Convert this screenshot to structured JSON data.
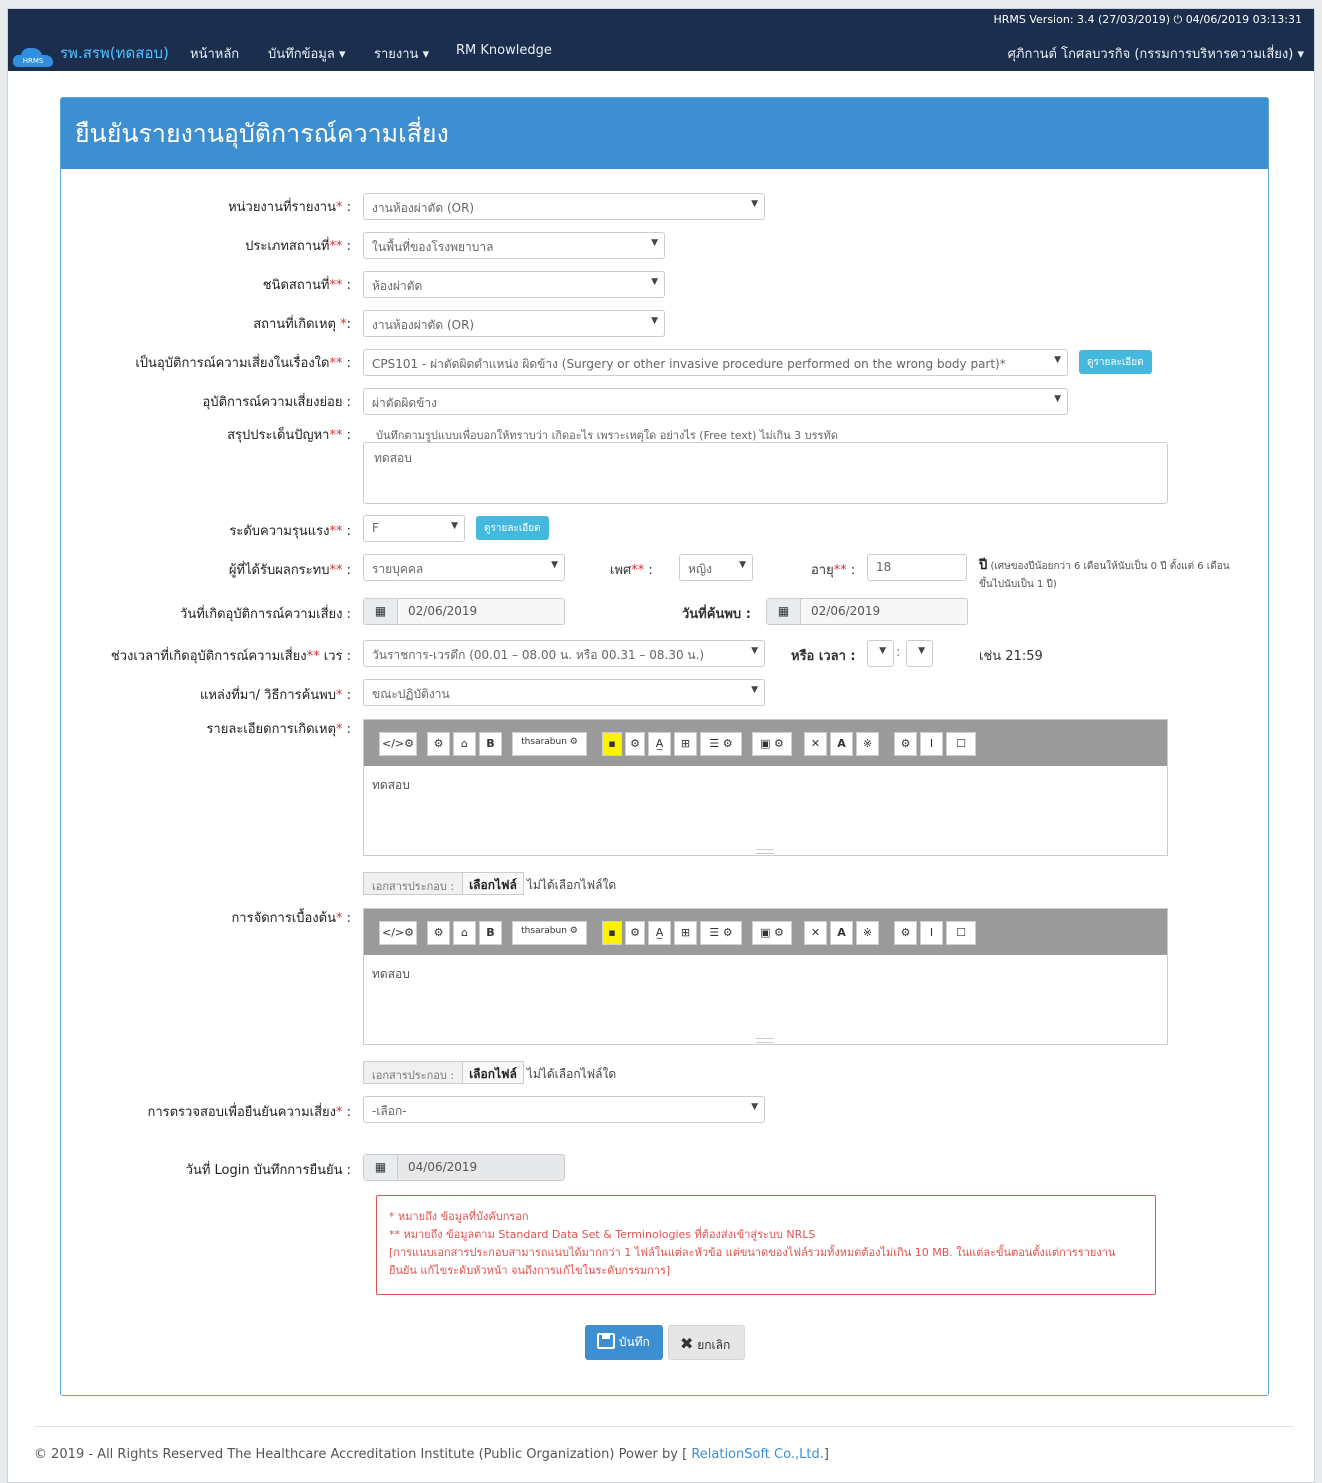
{
  "nav": {
    "version": "HRMS Version: 3.4 (27/03/2019) ⏻ 04/06/2019 03:13:31",
    "logo_text": "HRMS",
    "brand": "รพ.สรพ(ทดสอบ)",
    "items": [
      "หน้าหลัก",
      "บันทึกข้อมูล ▾",
      "รายงาน ▾",
      "RM Knowledge"
    ],
    "user": "ศุภิกานต์ โกศลบวรกิจ (กรรมการบริหารความเสี่ยง) ▾"
  },
  "panel_title": "ยืนยันรายงานอุบัติการณ์ความเสี่ยง",
  "form": {
    "unit": {
      "label": "หน่วยงานที่รายงาน",
      "req": "*",
      "value": "งานห้องผ่าตัด (OR)"
    },
    "place_type": {
      "label": "ประเภทสถานที่",
      "req": "**",
      "value": "ในพื้นที่ของโรงพยาบาล"
    },
    "place_kind": {
      "label": "ชนิดสถานที่",
      "req": "**",
      "value": "ห้องผ่าตัด"
    },
    "place": {
      "label": "สถานที่เกิดเหตุ",
      "req": "*",
      "value": "งานห้องผ่าตัด (OR)"
    },
    "risk_topic": {
      "label": "เป็นอุบัติการณ์ความเสี่ยงในเรื่องใด",
      "req": "**",
      "value": "CPS101 - ผ่าตัดผิดตำแหน่ง ผิดข้าง (Surgery or other invasive procedure performed on the wrong body part)*",
      "detail_btn": "ดูรายละเอียด"
    },
    "sub_risk": {
      "label": "อุบัติการณ์ความเสี่ยงย่อย",
      "value": "ผ่าตัดผิดข้าง"
    },
    "summary": {
      "label": "สรุปประเด็นปัญหา",
      "req": "**",
      "help": "บันทึกตามรูปแบบเพื่อบอกให้ทราบว่า เกิดอะไร เพราะเหตุใด อย่างไร (Free text) ไม่เกิน 3 บรรทัด",
      "value": "ทดสอบ"
    },
    "severity": {
      "label": "ระดับความรุนแรง",
      "req": "**",
      "value": "F",
      "detail_btn": "ดูรายละเอียด"
    },
    "affected": {
      "label": "ผู้ที่ได้รับผลกระทบ",
      "req": "**",
      "value": "รายบุคคล"
    },
    "sex": {
      "label": "เพศ",
      "req": "**",
      "value": "หญิง"
    },
    "age": {
      "label": "อายุ",
      "req": "**",
      "value": "18",
      "unit": "ปี",
      "note": "(เศษของปีน้อยกว่า 6 เดือนให้นับเป็น 0 ปี ตั้งแต่ 6 เดือนขึ้นไปนับเป็น 1 ปี)"
    },
    "occur_date": {
      "label": "วันที่เกิดอุบัติการณ์ความเสี่ยง",
      "value": "02/06/2019"
    },
    "found_date": {
      "label": "วันที่ค้นพบ",
      "value": "02/06/2019"
    },
    "period": {
      "label": "ช่วงเวลาที่เกิดอุบัติการณ์ความเสี่ยง",
      "req": "**",
      "suffix": " เวร",
      "value": "วันราชการ-เวรดึก (00.01 – 08.00 น. หรือ 00.31 – 08.30 น.)",
      "time_label": "หรือ เวลา",
      "example": "เช่น 21:59"
    },
    "source": {
      "label": "แหล่งที่มา/ วิธีการค้นพบ",
      "req": "*",
      "value": "ขณะปฏิบัติงาน"
    },
    "detail": {
      "label": "รายละเอียดการเกิดเหตุ",
      "req": "*",
      "value": "ทดสอบ"
    },
    "initial": {
      "label": "การจัดการเบื้องต้น",
      "req": "*",
      "value": "ทดสอบ"
    },
    "file": {
      "caption": "เอกสารประกอบ :",
      "choose": "เลือกไฟล์",
      "none": "ไม่ได้เลือกไฟล์ใด"
    },
    "verify": {
      "label": "การตรวจสอบเพื่อยืนยันความเสี่ยง",
      "req": "*",
      "value": "-เลือก-"
    },
    "login_date": {
      "label": "วันที่ Login บันทึกการยืนยัน",
      "value": "04/06/2019"
    }
  },
  "toolbar": [
    "</>",
    "⚙",
    "⌂",
    "B",
    "thsarabun",
    "▪",
    "⚙",
    "A̲",
    "⊞",
    "☰",
    "▣",
    "✕",
    "A",
    "※",
    "⚙",
    "I",
    "☐"
  ],
  "notes": [
    "* หมายถึง ข้อมูลที่บังคับกรอก",
    "** หมายถึง ข้อมูลตาม Standard Data Set & Terminologies ที่ต้องส่งเข้าสู่ระบบ NRLS",
    "[การแนบเอกสารประกอบสามารถแนบได้มากกว่า 1 ไฟล์ในแต่ละหัวข้อ แต่ขนาดของไฟล์รวมทั้งหมดต้องไม่เกิน 10 MB. ในแต่ละขั้นตอนตั้งแต่การรายงาน",
    "ยืนยัน แก้ไขระดับหัวหน้า จนถึงการแก้ไขในระดับกรรมการ]"
  ],
  "buttons": {
    "save": "บันทึก",
    "cancel": "ยกเลิก"
  },
  "footer": {
    "text": "© 2019 - All Rights Reserved The Healthcare Accreditation Institute (Public Organization) Power by [",
    "link": "RelationSoft Co.,Ltd.",
    "close": "]"
  },
  "colors": {
    "navbar": "#1c2e4d",
    "panel_head": "#3e8ed2",
    "required": "#d9303a",
    "info_button": "#44b8dd"
  }
}
